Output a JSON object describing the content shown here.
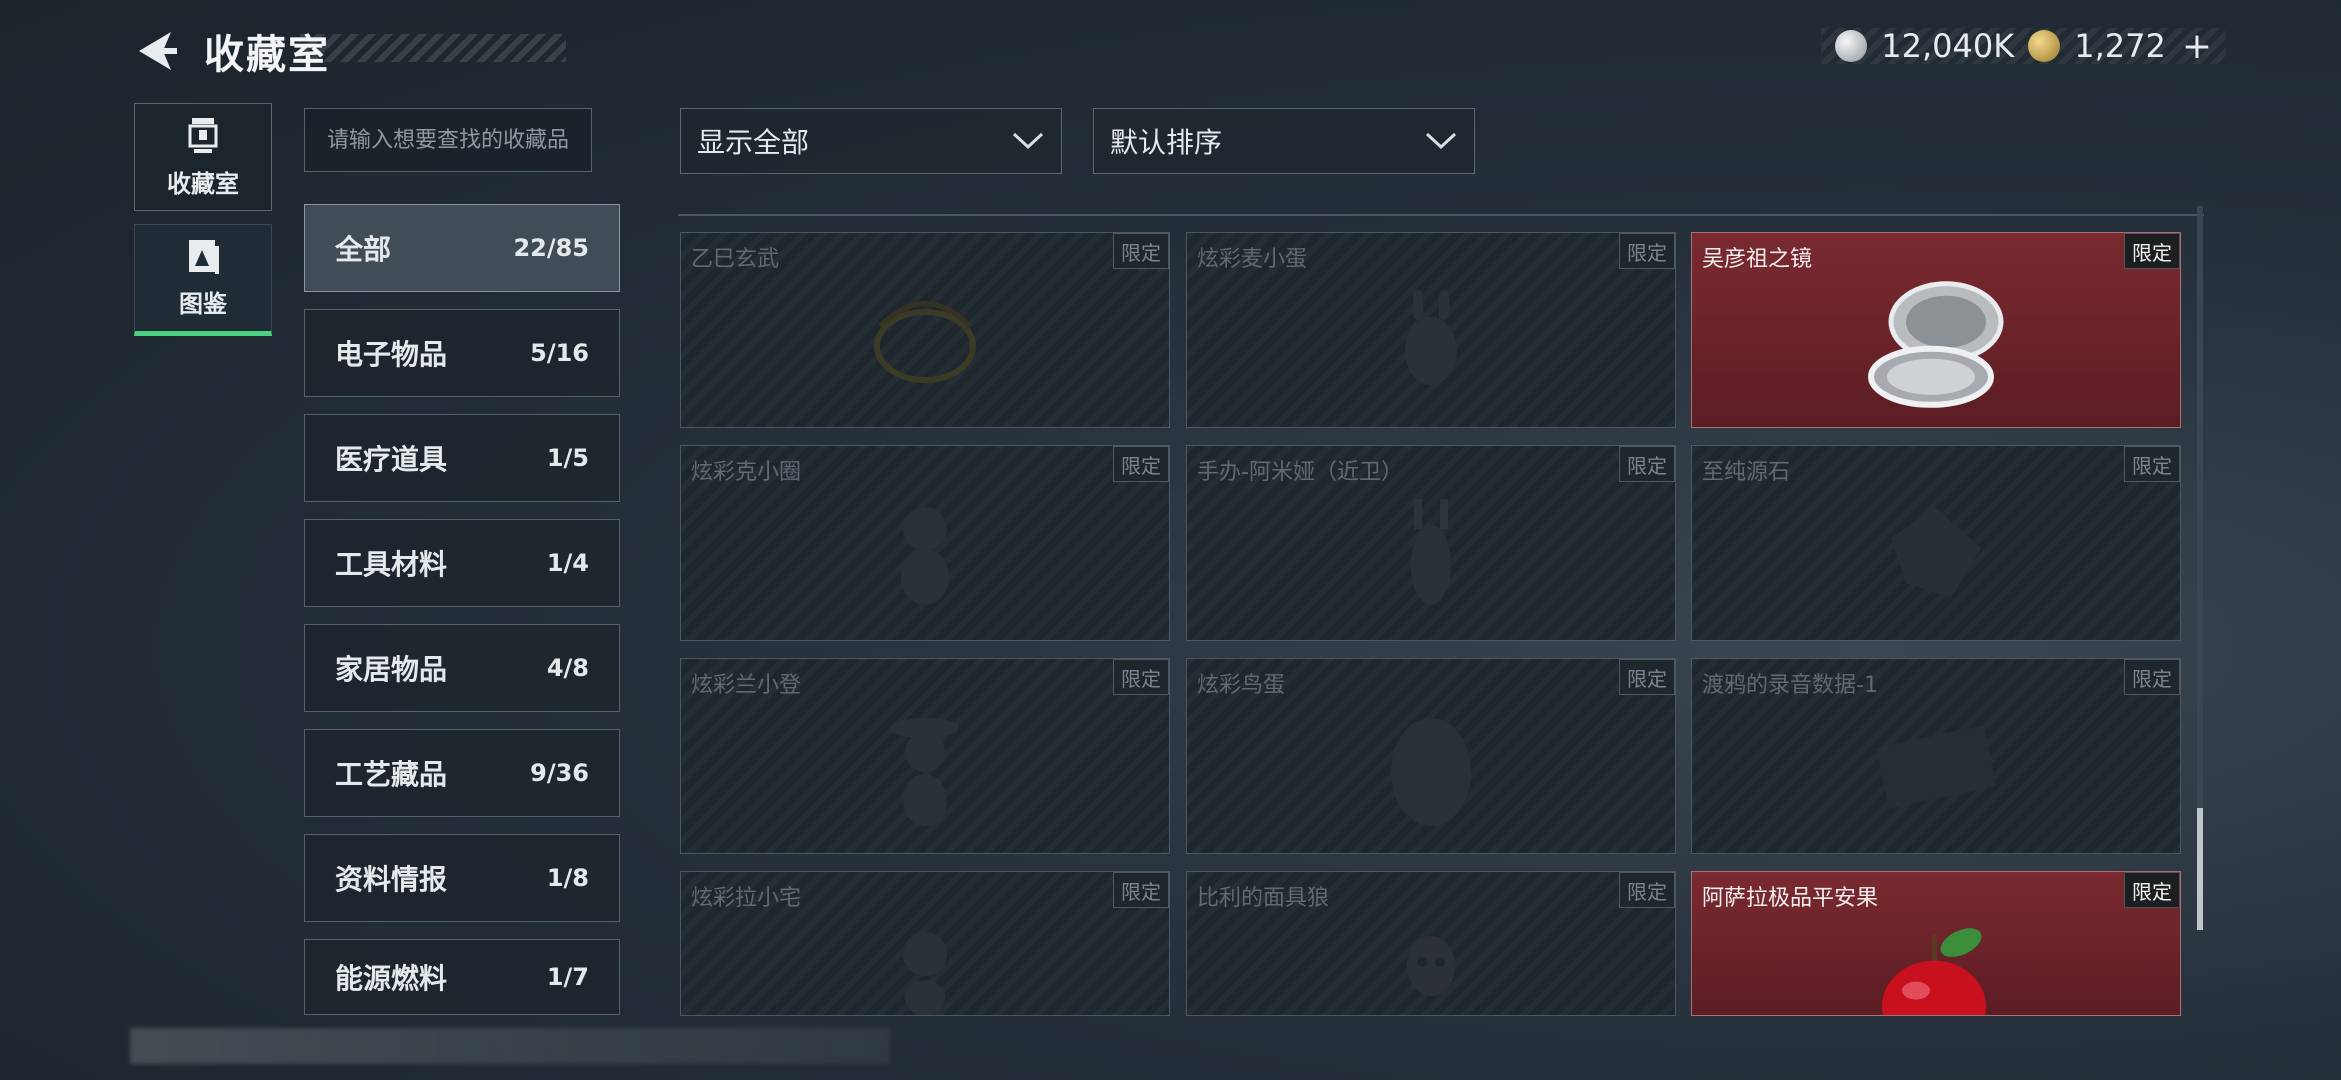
{
  "header": {
    "title": "收藏室",
    "currency": [
      {
        "icon": "silver-coin-icon",
        "value": "12,040K"
      },
      {
        "icon": "gold-coin-icon",
        "value": "1,272"
      }
    ],
    "plus_label": "+"
  },
  "sidenav": [
    {
      "label": "收藏室",
      "icon": "trophy-icon",
      "active": false
    },
    {
      "label": "图鉴",
      "icon": "catalog-icon",
      "active": true
    }
  ],
  "search": {
    "placeholder": "请输入想要查找的收藏品"
  },
  "categories": [
    {
      "name": "全部",
      "count": "22/85",
      "active": true
    },
    {
      "name": "电子物品",
      "count": "5/16"
    },
    {
      "name": "医疗道具",
      "count": "1/5"
    },
    {
      "name": "工具材料",
      "count": "1/4"
    },
    {
      "name": "家居物品",
      "count": "4/8"
    },
    {
      "name": "工艺藏品",
      "count": "9/36"
    },
    {
      "name": "资料情报",
      "count": "1/8"
    },
    {
      "name": "能源燃料",
      "count": "1/7"
    }
  ],
  "filters": {
    "show": "显示全部",
    "sort": "默认排序"
  },
  "items": [
    {
      "name": "乙巳玄武",
      "tag": "限定",
      "owned": false
    },
    {
      "name": "炫彩麦小蛋",
      "tag": "限定",
      "owned": false
    },
    {
      "name": "吴彦祖之镜",
      "tag": "限定",
      "owned": true
    },
    {
      "name": "炫彩克小圈",
      "tag": "限定",
      "owned": false
    },
    {
      "name": "手办-阿米娅（近卫）",
      "tag": "限定",
      "owned": false
    },
    {
      "name": "至纯源石",
      "tag": "限定",
      "owned": false
    },
    {
      "name": "炫彩兰小登",
      "tag": "限定",
      "owned": false
    },
    {
      "name": "炫彩鸟蛋",
      "tag": "限定",
      "owned": false
    },
    {
      "name": "渡鸦的录音数据-1",
      "tag": "限定",
      "owned": false
    },
    {
      "name": "炫彩拉小宅",
      "tag": "限定",
      "owned": false
    },
    {
      "name": "比利的面具狼",
      "tag": "限定",
      "owned": false
    },
    {
      "name": "阿萨拉极品平安果",
      "tag": "限定",
      "owned": true
    }
  ],
  "colors": {
    "accent_green": "#49d27f",
    "owned_red": "#7a2a30"
  }
}
